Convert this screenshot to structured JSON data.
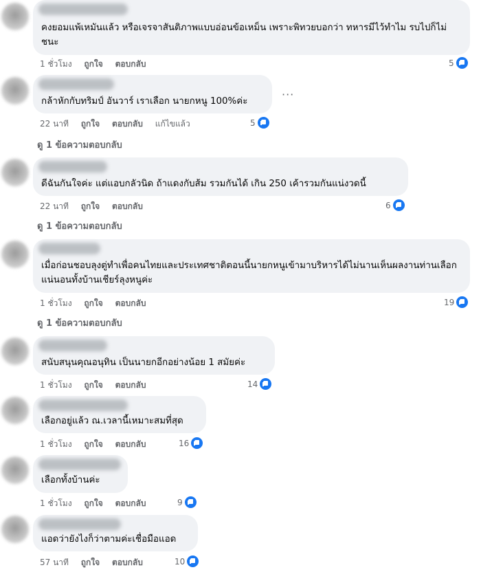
{
  "comments": [
    {
      "text": "คงยอมแพ้เหมันแล้ว หรือเจรจาสันติภาพแบบอ่อนข้อเหม็น เพราะพิทวยบอกว่า ทหารมีไว้ทำไม รบไปก็ไม่ชนะ",
      "time": "1 ชั่วโมง",
      "like": "ถูกใจ",
      "reply": "ตอบกลับ",
      "edited": "",
      "reactions": "5",
      "replies": ""
    },
    {
      "text": "กล้าหักกับทริมป์ อันวาร์ เราเลือก นายกหนู 100%ค่ะ",
      "time": "22 นาที",
      "like": "ถูกใจ",
      "reply": "ตอบกลับ",
      "edited": "แก้ไขแล้ว",
      "reactions": "5",
      "replies": "ดู 1 ข้อความตอบกลับ",
      "more": "···"
    },
    {
      "text": "ดีฉันกันใจค่ะ แต่แอบกลัวนิด ถ้าแดงกับส้ม รวมกันได้ เกิน 250 เค้ารวมกันแน่งวดนี้",
      "time": "22 นาที",
      "like": "ถูกใจ",
      "reply": "ตอบกลับ",
      "edited": "",
      "reactions": "6",
      "replies": "ดู 1 ข้อความตอบกลับ"
    },
    {
      "text": "เมื่อก่อนชอบลุงตู่ทำเพื่อคนไทยและประเทศชาติตอนนี้นายกหนูเข้ามาบริหารได้ไม่นานเห็นผลงานท่านเลือกแน่นอนทั้งบ้านเชียร์ลุงหนูค่ะ",
      "time": "1 ชั่วโมง",
      "like": "ถูกใจ",
      "reply": "ตอบกลับ",
      "edited": "",
      "reactions": "19",
      "replies": "ดู 1 ข้อความตอบกลับ"
    },
    {
      "text": "สนับสนุนคุณอนุทิน เป็นนายกอีกอย่างน้อย 1 สมัยค่ะ",
      "time": "1 ชั่วโมง",
      "like": "ถูกใจ",
      "reply": "ตอบกลับ",
      "edited": "",
      "reactions": "14",
      "replies": ""
    },
    {
      "text": "เลือกอยู่แล้ว ณ.เวลานี้เหมาะสมที่สุด",
      "time": "1 ชั่วโมง",
      "like": "ถูกใจ",
      "reply": "ตอบกลับ",
      "edited": "",
      "reactions": "16",
      "replies": ""
    },
    {
      "text": "เลือกทั้งบ้านค่ะ",
      "time": "1 ชั่วโมง",
      "like": "ถูกใจ",
      "reply": "ตอบกลับ",
      "edited": "",
      "reactions": "9",
      "replies": ""
    },
    {
      "text": "แอดว่ายังไงก็ว่าตามค่ะเชื่อมือแอด",
      "time": "57 นาที",
      "like": "ถูกใจ",
      "reply": "ตอบกลับ",
      "edited": "",
      "reactions": "10",
      "replies": ""
    }
  ],
  "colors": {
    "bubble": "#f0f2f5",
    "meta": "#65676b",
    "like": "#1877f2"
  }
}
